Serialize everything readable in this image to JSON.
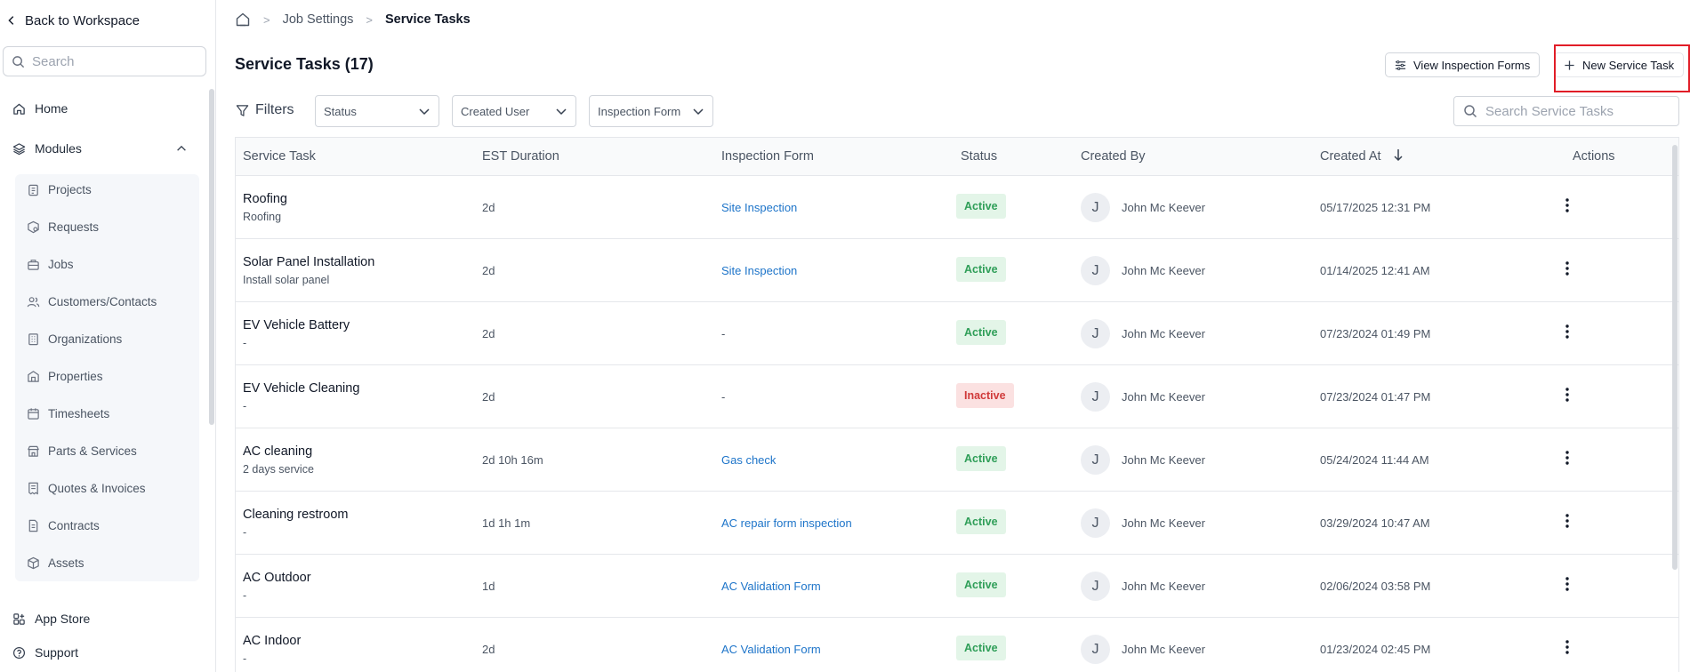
{
  "sidebar": {
    "back_label": "Back to Workspace",
    "search_placeholder": "Search",
    "home_label": "Home",
    "modules_label": "Modules",
    "modules": [
      {
        "label": "Projects",
        "icon": "clipboard-icon"
      },
      {
        "label": "Requests",
        "icon": "package-search-icon"
      },
      {
        "label": "Jobs",
        "icon": "briefcase-icon"
      },
      {
        "label": "Customers/Contacts",
        "icon": "users-icon"
      },
      {
        "label": "Organizations",
        "icon": "building-icon"
      },
      {
        "label": "Properties",
        "icon": "property-icon"
      },
      {
        "label": "Timesheets",
        "icon": "calendar-icon"
      },
      {
        "label": "Parts & Services",
        "icon": "store-icon"
      },
      {
        "label": "Quotes & Invoices",
        "icon": "receipt-icon"
      },
      {
        "label": "Contracts",
        "icon": "document-icon"
      },
      {
        "label": "Assets",
        "icon": "cube-icon"
      }
    ],
    "app_store_label": "App Store",
    "support_label": "Support"
  },
  "breadcrumb": {
    "items": [
      "Job Settings",
      "Service Tasks"
    ]
  },
  "header": {
    "title": "Service Tasks (17)",
    "view_forms_label": "View Inspection Forms",
    "new_task_label": "New Service Task"
  },
  "filters": {
    "label": "Filters",
    "status": "Status",
    "created_user": "Created User",
    "inspection_form": "Inspection Form",
    "search_placeholder": "Search Service Tasks"
  },
  "table": {
    "columns": [
      "Service Task",
      "EST Duration",
      "Inspection Form",
      "Status",
      "Created By",
      "Created At",
      "Actions"
    ],
    "rows": [
      {
        "name": "Roofing",
        "sub": "Roofing",
        "duration": "2d",
        "form": "Site Inspection",
        "status": "Active",
        "initial": "J",
        "by": "John Mc Keever",
        "at": "05/17/2025 12:31 PM"
      },
      {
        "name": "Solar Panel Installation",
        "sub": "Install solar panel",
        "duration": "2d",
        "form": "Site Inspection",
        "status": "Active",
        "initial": "J",
        "by": "John Mc Keever",
        "at": "01/14/2025 12:41 AM"
      },
      {
        "name": "EV Vehicle Battery",
        "sub": "-",
        "duration": "2d",
        "form": "-",
        "status": "Active",
        "initial": "J",
        "by": "John Mc Keever",
        "at": "07/23/2024 01:49 PM"
      },
      {
        "name": "EV Vehicle Cleaning",
        "sub": "-",
        "duration": "2d",
        "form": "-",
        "status": "Inactive",
        "initial": "J",
        "by": "John Mc Keever",
        "at": "07/23/2024 01:47 PM"
      },
      {
        "name": "AC cleaning",
        "sub": "2 days service",
        "duration": "2d 10h 16m",
        "form": "Gas check",
        "status": "Active",
        "initial": "J",
        "by": "John Mc Keever",
        "at": "05/24/2024 11:44 AM"
      },
      {
        "name": "Cleaning restroom",
        "sub": "-",
        "duration": "1d 1h 1m",
        "form": "AC repair form inspection",
        "status": "Active",
        "initial": "J",
        "by": "John Mc Keever",
        "at": "03/29/2024 10:47 AM"
      },
      {
        "name": "AC Outdoor",
        "sub": "-",
        "duration": "1d",
        "form": "AC Validation Form",
        "status": "Active",
        "initial": "J",
        "by": "John Mc Keever",
        "at": "02/06/2024 03:58 PM"
      },
      {
        "name": "AC Indoor",
        "sub": "-",
        "duration": "2d",
        "form": "AC Validation Form",
        "status": "Active",
        "initial": "J",
        "by": "John Mc Keever",
        "at": "01/23/2024 02:45 PM"
      }
    ]
  },
  "colors": {
    "link": "#1d74c9",
    "active_bg": "#e3f5e8",
    "active_text": "#2f9e58",
    "inactive_bg": "#fbe1e1",
    "inactive_text": "#d03a3a",
    "highlight": "#e11d27"
  }
}
